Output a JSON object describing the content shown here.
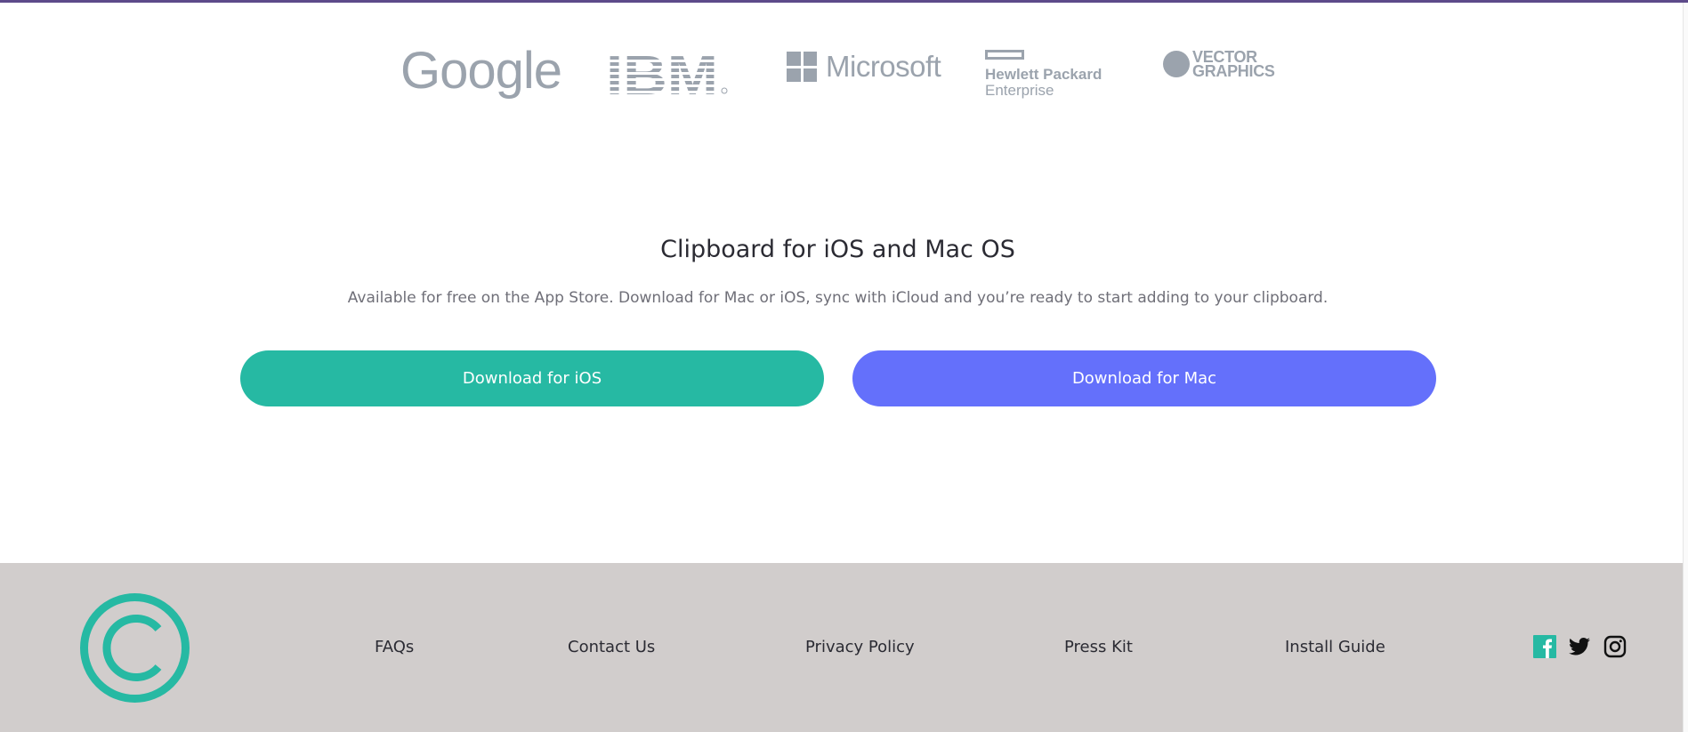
{
  "logos": {
    "google": "Google",
    "ibm": "IBM",
    "microsoft": "Microsoft",
    "hpe_line1": "Hewlett Packard",
    "hpe_line2": "Enterprise",
    "vector_line1": "VECTOR",
    "vector_line2": "GRAPHICS"
  },
  "cta": {
    "title": "Clipboard for iOS and Mac OS",
    "description": "Available for free on the App Store. Download for Mac or iOS, sync with iCloud and you’re ready to start adding to your clipboard.",
    "ios_button": "Download for iOS",
    "mac_button": "Download for Mac"
  },
  "footer": {
    "links": [
      "FAQs",
      "Contact Us",
      "Privacy Policy",
      "Press Kit",
      "Install Guide"
    ],
    "social_icons": [
      "facebook-icon",
      "twitter-icon",
      "instagram-icon"
    ]
  },
  "colors": {
    "accent_teal": "#26b9a3",
    "accent_blue": "#6470fb",
    "footer_bg": "#d1cdcc",
    "logo_gray": "#9ba3ad"
  }
}
